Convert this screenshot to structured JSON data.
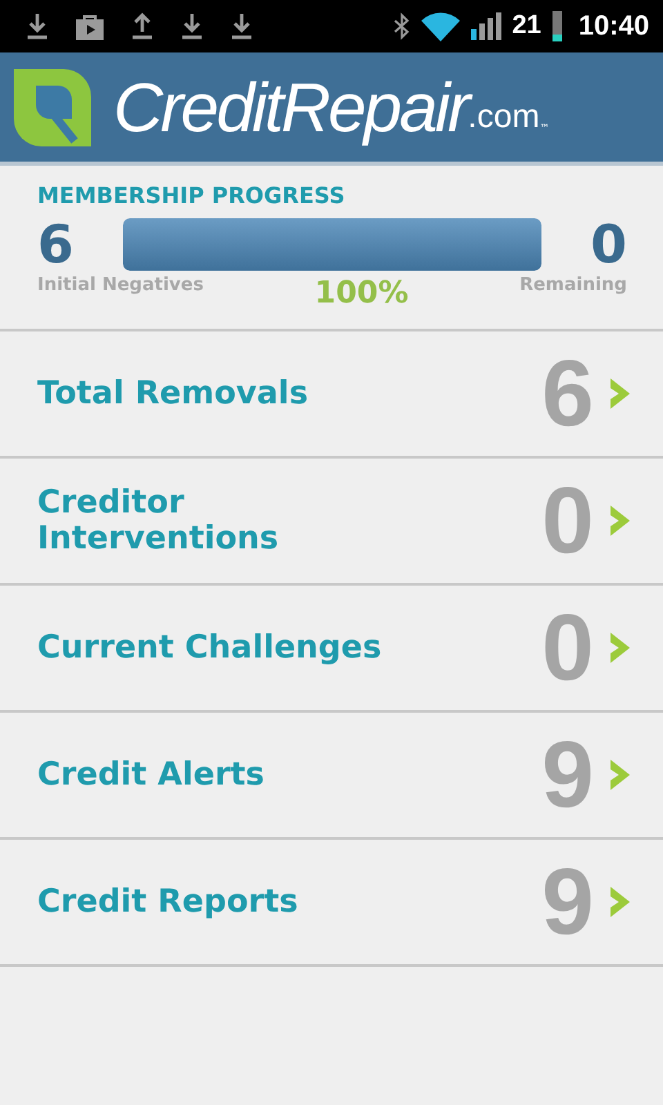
{
  "status_bar": {
    "notifications": [
      {
        "kind": "download"
      },
      {
        "kind": "store"
      },
      {
        "kind": "upload"
      },
      {
        "kind": "download"
      },
      {
        "kind": "download"
      }
    ],
    "battery_text": "21",
    "time": "10:40"
  },
  "header": {
    "brand": "CreditRepair",
    "brand_suffix": ".com",
    "trademark": "™"
  },
  "progress": {
    "title": "MEMBERSHIP PROGRESS",
    "initial_count": "6",
    "initial_label": "Initial Negatives",
    "remaining_count": "0",
    "remaining_label": "Remaining",
    "level": 1,
    "percent": "100%"
  },
  "items": [
    {
      "label": "Total Removals",
      "count": "6"
    },
    {
      "label": "Creditor Interventions",
      "count": "0"
    },
    {
      "label": "Current Challenges",
      "count": "0"
    },
    {
      "label": "Credit Alerts",
      "count": "9"
    },
    {
      "label": "Credit Reports",
      "count": "9"
    }
  ]
}
